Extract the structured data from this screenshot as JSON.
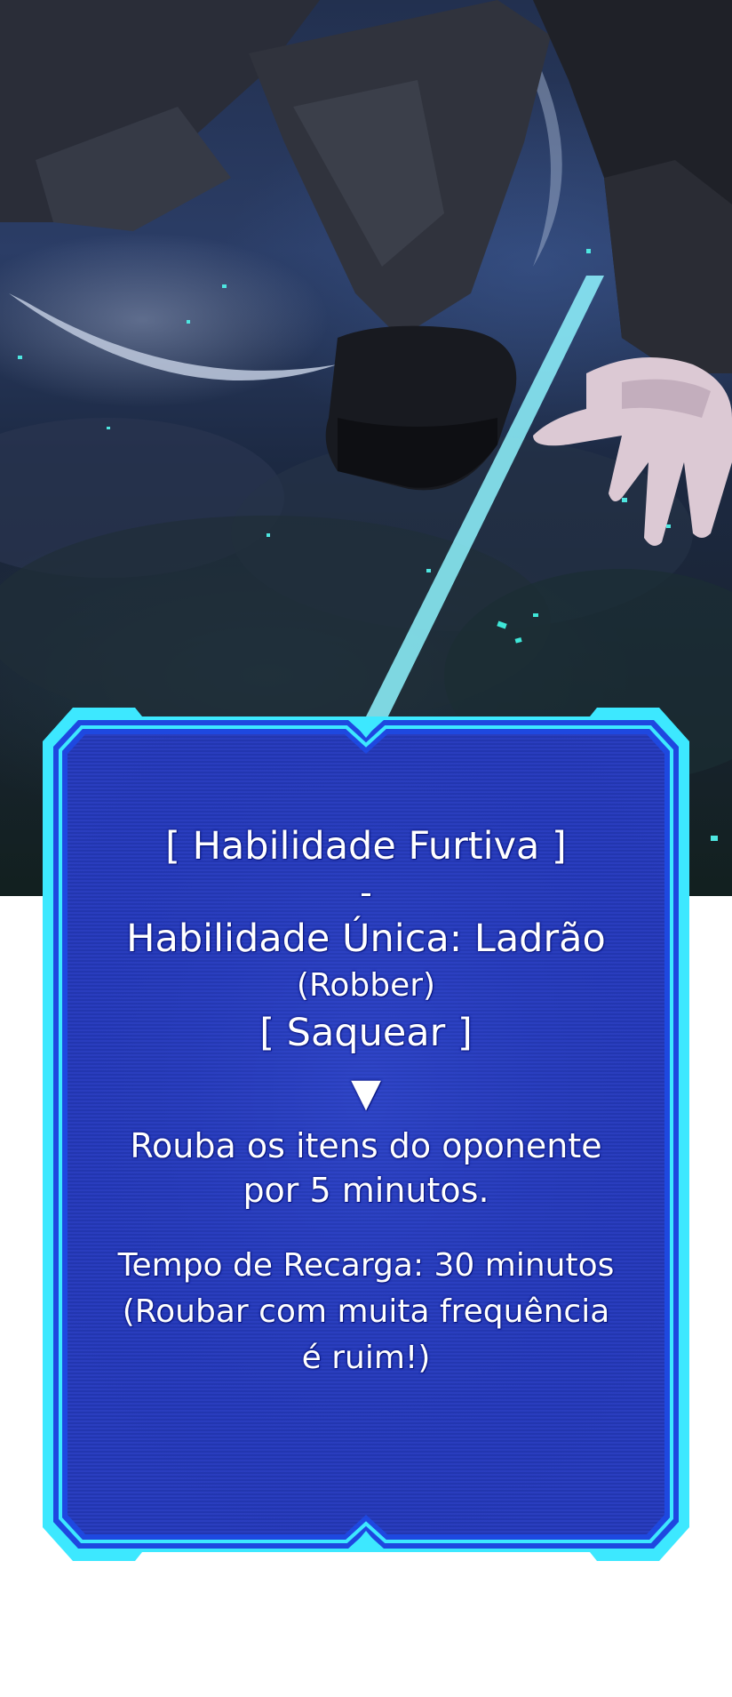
{
  "skill_box": {
    "header": "[ Habilidade Furtiva ]",
    "dash": "-",
    "skill_class": "Habilidade Única: Ladrão",
    "skill_class_original": "(Robber)",
    "skill_name": "[ Saquear ]",
    "arrow": "▼",
    "description_lines": [
      "Rouba os itens do oponente",
      "por 5 minutos."
    ],
    "cooldown_lines": [
      "Tempo de Recarga: 30 minutos",
      "(Roubar com muita frequência",
      "é ruim!)"
    ]
  },
  "colors": {
    "frame_cyan": "#3de8ff",
    "frame_blue": "#1e48e0",
    "panel_fill": "#2436b8",
    "text_outline": "#0a1780",
    "page_background": "#ffffff"
  }
}
